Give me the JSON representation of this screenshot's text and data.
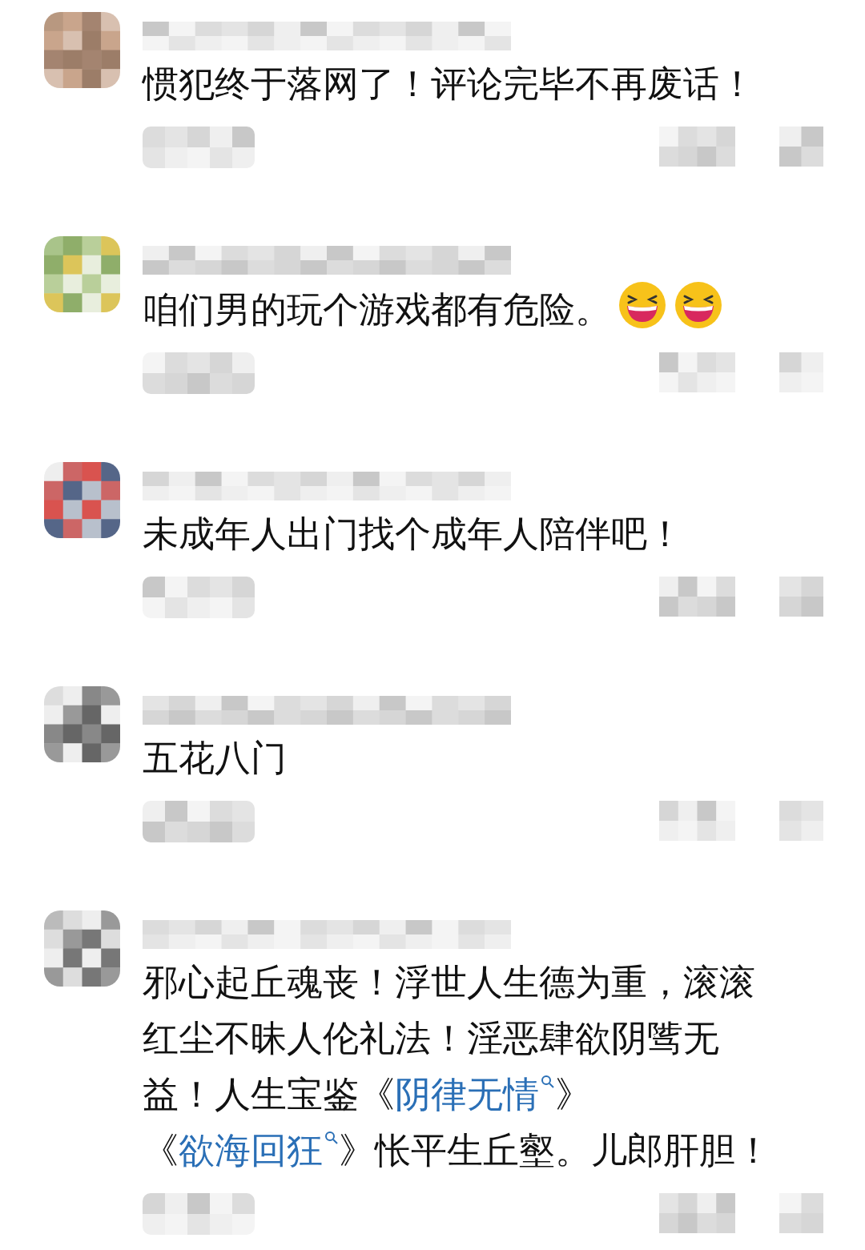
{
  "comments": [
    {
      "segments": [
        {
          "kind": "plain",
          "text": "惯犯终于落网了！评论完毕不再废话！"
        }
      ]
    },
    {
      "segments": [
        {
          "kind": "plain",
          "text": "咱们男的玩个游戏都有危险。"
        }
      ],
      "emojis": [
        {
          "kind": "laugh"
        },
        {
          "kind": "laugh"
        }
      ]
    },
    {
      "segments": [
        {
          "kind": "plain",
          "text": "未成年人出门找个成年人陪伴吧！"
        }
      ]
    },
    {
      "segments": [
        {
          "kind": "plain",
          "text": "五花八门"
        }
      ]
    },
    {
      "segments": [
        {
          "kind": "plain",
          "text": "邪心起丘魂丧！浮世人生德为重，滚滚红尘不昧人伦礼法！淫恶肆欲阴骘无益！人生宝鉴《"
        },
        {
          "kind": "link",
          "text": "阴律无情"
        },
        {
          "kind": "plain",
          "text": "》《"
        },
        {
          "kind": "link",
          "text": "欲海回狂"
        },
        {
          "kind": "plain",
          "text": "》怅平生丘壑。儿郎肝胆！"
        }
      ]
    }
  ]
}
